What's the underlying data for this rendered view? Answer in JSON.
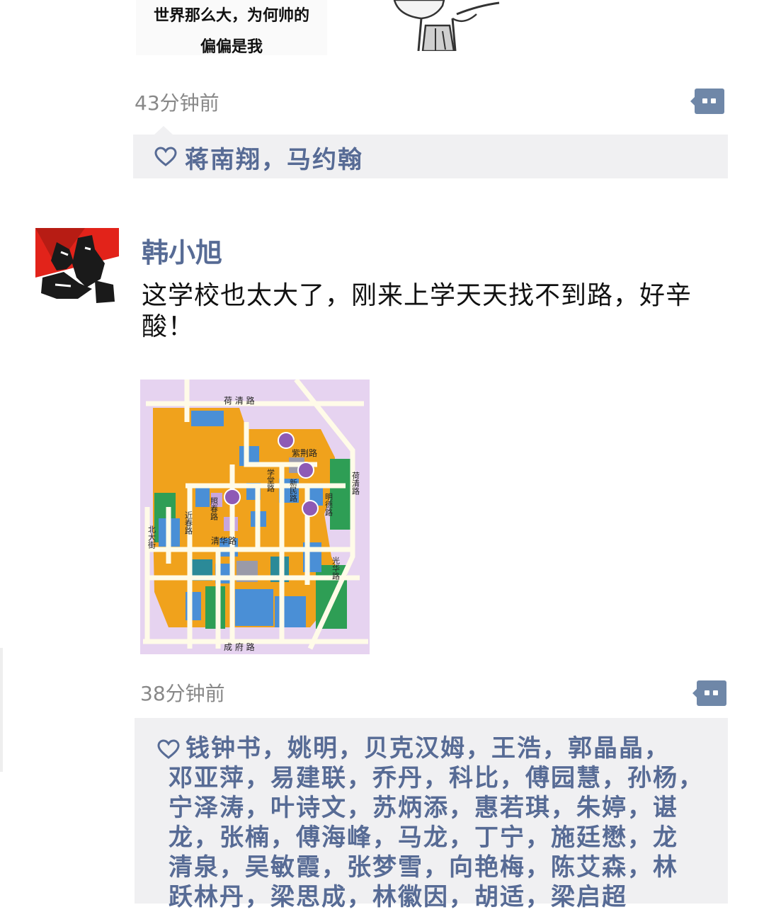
{
  "post1": {
    "meme_caption_line1": "世界那么大，为何帅的",
    "meme_caption_line2": "偏偏是我",
    "time": "43分钟前",
    "likes": "蒋南翔，马约翰"
  },
  "post2": {
    "username": "韩小旭",
    "text": "这学校也太大了，刚来上学天天找不到路，好辛酸！",
    "map_labels": {
      "top_road": "荷 清 路",
      "zijing_road": "紫荆路",
      "heqing_right": "荷清路",
      "xuetang": "学堂路",
      "xinmin": "新民路",
      "mingde": "明德路",
      "zhaochun": "照春路",
      "jinchun": "近春路",
      "beidajie": "北大街",
      "qinghua": "清华路",
      "guanghua": "光华路",
      "chengfu": "成 府 路"
    },
    "time": "38分钟前",
    "likes_lines": [
      "钱钟书，姚明，贝克汉姆，王浩，郭晶晶，",
      "邓亚萍，易建联，乔丹，科比，傅园慧，孙杨，",
      "宁泽涛，叶诗文，苏炳添，惠若琪，朱婷，谌",
      "龙，张楠，傅海峰，马龙，丁宁，施廷懋，龙",
      "清泉，吴敏霞，张梦雪，向艳梅，陈艾森，林",
      "跃林丹，梁思成，林徽因，胡适，梁启超"
    ]
  },
  "colors": {
    "link_blue": "#576b95",
    "likes_bg": "#f0f0f2",
    "timestamp": "#888888",
    "comment_button": "#6f87a8"
  },
  "icons": [
    "like-heart-icon",
    "comment-bubble-icon"
  ]
}
